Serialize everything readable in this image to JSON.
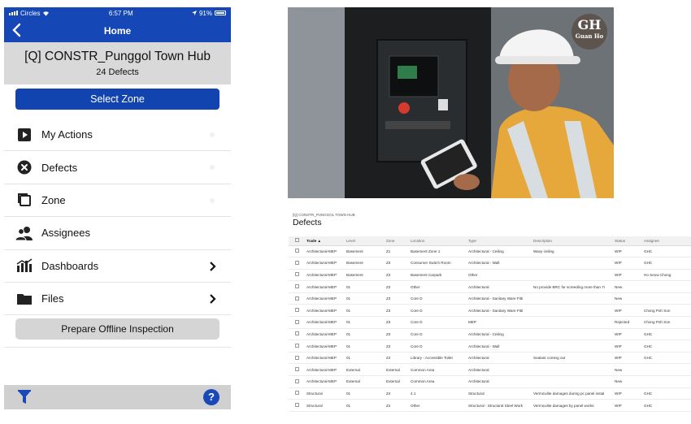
{
  "status_bar": {
    "carrier": "Circles",
    "time": "6:57 PM",
    "battery": "91%"
  },
  "nav": {
    "title": "Home"
  },
  "project": {
    "name": "[Q] CONSTR_Punggol Town Hub",
    "defect_count": "24 Defects"
  },
  "select_zone_label": "Select Zone",
  "menu": [
    {
      "label": "My Actions",
      "icon": "play-square-icon",
      "chevron": false
    },
    {
      "label": "Defects",
      "icon": "x-circle-icon",
      "chevron": false
    },
    {
      "label": "Zone",
      "icon": "copy-square-icon",
      "chevron": false
    },
    {
      "label": "Assignees",
      "icon": "people-icon",
      "chevron": false
    },
    {
      "label": "Dashboards",
      "icon": "bar-chart-icon",
      "chevron": true
    },
    {
      "label": "Files",
      "icon": "folder-icon",
      "chevron": true
    }
  ],
  "offline_label": "Prepare Offline Inspection",
  "toolbar": {
    "help_label": "?"
  },
  "watermark": {
    "mark": "GH",
    "text": "Guan Ho"
  },
  "defects_panel": {
    "project_label": "[Q] CONSTR_PUNGGOL TOWN HUB",
    "title": "Defects",
    "columns": [
      "Trade ▲",
      "Level",
      "Zone",
      "Location",
      "Type",
      "Description",
      "Status",
      "Assignee"
    ],
    "rows": [
      [
        "Architectural-MEP",
        "Basement",
        "Z1",
        "Basement Zone 1",
        "Architectural - Ceiling",
        "Wavy ceiling",
        "WIP",
        "GHC"
      ],
      [
        "Architectural-MEP",
        "Basement",
        "Z3",
        "Consumer Switch Room",
        "Architectural - Wall",
        "",
        "WIP",
        "GHC"
      ],
      [
        "Architectural-MEP",
        "Basement",
        "Z3",
        "Basement Carpark",
        "Other",
        "",
        "WIP",
        "Ho Seow Chong"
      ],
      [
        "Architectural-MEP",
        "01",
        "Z3",
        "Other",
        "Architectural",
        "No provide BRC for screeding more than 7i",
        "New",
        ""
      ],
      [
        "Architectural-MEP",
        "01",
        "Z3",
        "Core D",
        "Architectural - Sanitary Ware Fitti",
        "",
        "New",
        ""
      ],
      [
        "Architectural-MEP",
        "01",
        "Z3",
        "Core D",
        "Architectural - Sanitary Ware Fitti",
        "",
        "WIP",
        "Chong Poh Son"
      ],
      [
        "Architectural-MEP",
        "01",
        "Z3",
        "Core D",
        "MEP",
        "",
        "Rejected",
        "Chong Poh Son"
      ],
      [
        "Architectural-MEP",
        "01",
        "Z3",
        "Core D",
        "Architectural - Ceiling",
        "",
        "WIP",
        "GHC"
      ],
      [
        "Architectural-MEP",
        "01",
        "Z3",
        "Core D",
        "Architectural - Wall",
        "",
        "WIP",
        "GHC"
      ],
      [
        "Architectural-MEP",
        "01",
        "Z4",
        "Library - Accessible Toilet",
        "Architectural",
        "Sealant coming out",
        "WIP",
        "GHC"
      ],
      [
        "Architectural-MEP",
        "External",
        "External",
        "Common Area",
        "Architectural",
        "",
        "New",
        ""
      ],
      [
        "Architectural-MEP",
        "External",
        "External",
        "Common Area",
        "Architectural",
        "",
        "New",
        ""
      ],
      [
        "Structural",
        "01",
        "Z4",
        "4.1",
        "Structural",
        "Vermiculite damages during pc panel instal",
        "WIP",
        "GHC"
      ],
      [
        "Structural",
        "01",
        "Z4",
        "Other",
        "Structural - Structural Steel Work",
        "Vermiculite damages by panel works",
        "WIP",
        "GHC"
      ]
    ]
  }
}
